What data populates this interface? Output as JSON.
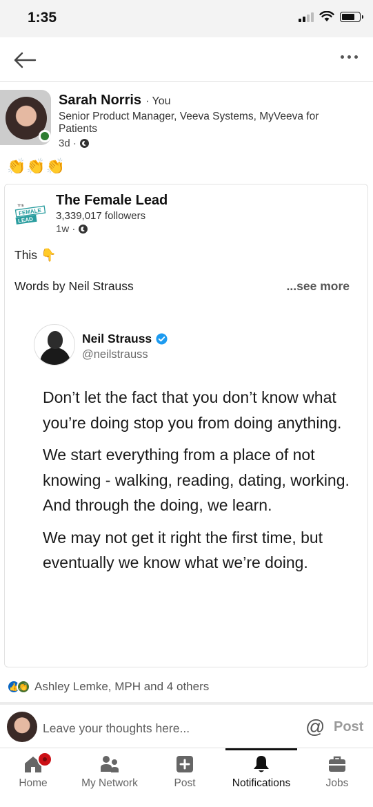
{
  "status_bar": {
    "time": "1:35"
  },
  "topbar": {
    "back_icon": "arrow-left-icon",
    "more_icon": "ellipsis-icon"
  },
  "post": {
    "author_name": "Sarah Norris",
    "author_relation": "· You",
    "author_headline": "Senior Product Manager, Veeva Systems, MyVeeva for Patients",
    "age": "3d ·",
    "body_emoji": "👏👏👏"
  },
  "shared": {
    "org_name": "The Female Lead",
    "followers": "3,339,017 followers",
    "age": "1w ·",
    "text": "This",
    "text_emoji": "👇",
    "credit": "Words by Neil Strauss",
    "see_more": "...see more",
    "logo_text": {
      "line1": "THE",
      "line2": "FEMALE",
      "line3": "LEAD"
    }
  },
  "tweet": {
    "name": "Neil Strauss",
    "handle": "@neilstrauss",
    "paragraphs": [
      "Don’t let the fact that you don’t know what you’re doing stop you from doing anything.",
      "We start everything from a place of not knowing - walking, reading, dating, working. And through the doing, we learn.",
      "We may not get it right the first time, but eventually we know what we’re doing."
    ]
  },
  "reactions": {
    "text": "Ashley Lemke, MPH and 4 others"
  },
  "comment": {
    "placeholder": "Leave your thoughts here...",
    "at_symbol": "@",
    "post_label": "Post"
  },
  "tabs": [
    {
      "label": "Home",
      "icon": "home-icon"
    },
    {
      "label": "My Network",
      "icon": "network-icon"
    },
    {
      "label": "Post",
      "icon": "plus-square-icon"
    },
    {
      "label": "Notifications",
      "icon": "bell-icon"
    },
    {
      "label": "Jobs",
      "icon": "briefcase-icon"
    }
  ],
  "colors": {
    "accent": "#0a66c2",
    "logo_teal": "#2a9d9f",
    "badge_red": "#cc1016"
  }
}
